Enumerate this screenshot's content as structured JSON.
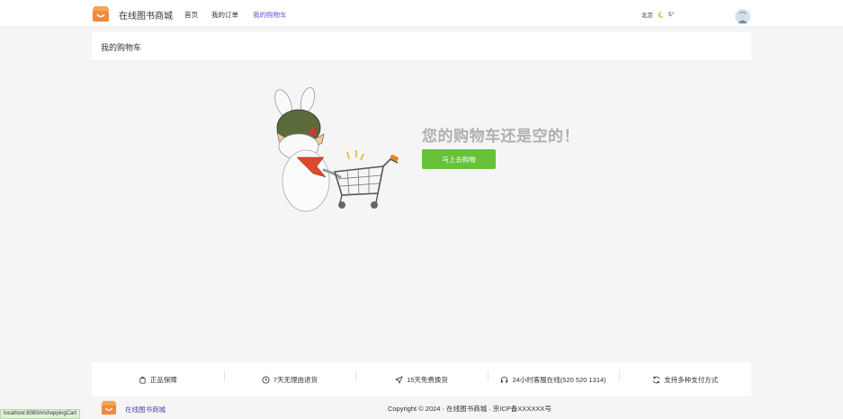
{
  "header": {
    "site_name": "在线图书商城",
    "nav": [
      {
        "label": "首页"
      },
      {
        "label": "我的订单"
      },
      {
        "label": "我的购物车"
      }
    ],
    "weather": {
      "city": "北京",
      "temperature": "5°",
      "icon": "moon-icon"
    }
  },
  "page": {
    "title": "我的购物车"
  },
  "empty_cart": {
    "message": "您的购物车还是空的！",
    "button_label": "马上去购物",
    "illustration": "bunny-with-cart-illustration"
  },
  "services": [
    {
      "icon": "bag-icon",
      "label": "正品保障"
    },
    {
      "icon": "clock-icon",
      "label": "7天无理由退货"
    },
    {
      "icon": "send-icon",
      "label": "15天免费换货"
    },
    {
      "icon": "headset-icon",
      "label": "24小时客服在线(520 520 1314)"
    },
    {
      "icon": "refresh-icon",
      "label": "支持多种支付方式"
    }
  ],
  "footer": {
    "site_name": "在线图书商城",
    "copyright": "Copyright © 2024 · 在线图书商城 · 京ICP备XXXXXX号"
  },
  "status_bar": {
    "url": "localhost:8080/#/shoppingCart"
  },
  "colors": {
    "accent_nav": "#5b5bd6",
    "button_green": "#67c23a",
    "logo_orange": "#f08a3c"
  }
}
